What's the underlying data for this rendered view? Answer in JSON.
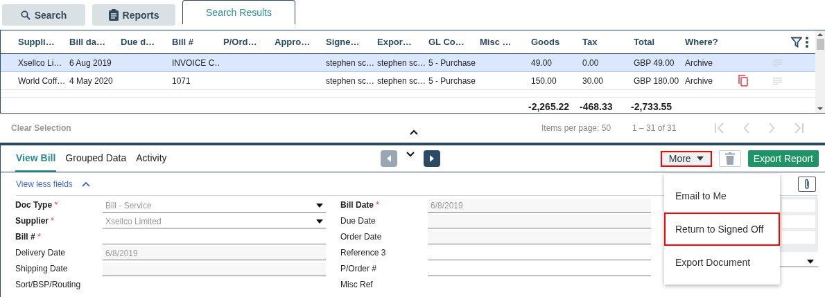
{
  "tabs": [
    {
      "label": "Search",
      "selected": false
    },
    {
      "label": "Reports",
      "selected": false
    },
    {
      "label": "Search Results",
      "selected": true
    }
  ],
  "table": {
    "columns": [
      "Suppli…",
      "Bill da…",
      "Due d…",
      "Bill #",
      "P/Ord…",
      "Appro…",
      "Signe…",
      "Expor…",
      "GL Co…",
      "Misc …",
      "Goods",
      "Tax",
      "Total",
      "Where?"
    ],
    "rows": [
      {
        "selected": true,
        "copy": false,
        "cells": [
          "Xsellco Li…",
          "6 Aug 2019",
          "",
          "INVOICE C…",
          "",
          "",
          "stephen sc…",
          "stephen sc…",
          "5 - Purchase",
          "",
          "49.00",
          "0.00",
          "GBP 49.00",
          "Archive"
        ]
      },
      {
        "selected": false,
        "copy": true,
        "cells": [
          "World Coff…",
          "4 May 2020",
          "",
          "1071",
          "",
          "",
          "stephen sc…",
          "stephen sc…",
          "5 - Purchase",
          "",
          "150.00",
          "30.00",
          "GBP 180.00",
          "Archive"
        ]
      }
    ],
    "totals": {
      "goods": "-2,265.22",
      "tax": "-468.33",
      "total": "-2,733.55"
    }
  },
  "footer": {
    "clear": "Clear Selection",
    "items_per_page": "Items per page: 50",
    "range": "1 – 31 of 31"
  },
  "detail_tabs": [
    {
      "label": "View Bill",
      "selected": true
    },
    {
      "label": "Grouped Data",
      "selected": false
    },
    {
      "label": "Activity",
      "selected": false
    }
  ],
  "nav": {
    "prev_disabled": true,
    "next_disabled": false
  },
  "more": {
    "label": "More",
    "highlighted": true
  },
  "export_button": "Export Report",
  "menu": [
    {
      "label": "Email to Me",
      "highlighted": false
    },
    {
      "label": "Return to Signed Off",
      "highlighted": true
    },
    {
      "label": "Export Document",
      "highlighted": false
    }
  ],
  "toggle": "View less fields",
  "form_left": [
    {
      "label": "Doc Type",
      "required_mark": "*",
      "kind": "select",
      "value": "Bill - Service"
    },
    {
      "label": "Supplier",
      "required_mark": "*",
      "kind": "select",
      "value": "Xsellco Limited"
    },
    {
      "label": "Bill #",
      "required_mark": "*",
      "kind": "text"
    },
    {
      "label": "Delivery Date",
      "kind": "readonly",
      "value": "6/8/2019"
    },
    {
      "label": "Shipping Date",
      "kind": "readonly"
    },
    {
      "label": "Sort/BSP/Routing",
      "kind": "none"
    }
  ],
  "form_mid": [
    {
      "label": "Bill Date",
      "required_mark": "*",
      "kind": "readonly",
      "value": "6/8/2019"
    },
    {
      "label": "Due Date",
      "kind": "readonly"
    },
    {
      "label": "Order Date",
      "kind": "readonly"
    },
    {
      "label": "Reference 3",
      "kind": "text"
    },
    {
      "label": "P/Order #",
      "kind": "text"
    },
    {
      "label": "Misc Ref",
      "kind": "none"
    }
  ]
}
